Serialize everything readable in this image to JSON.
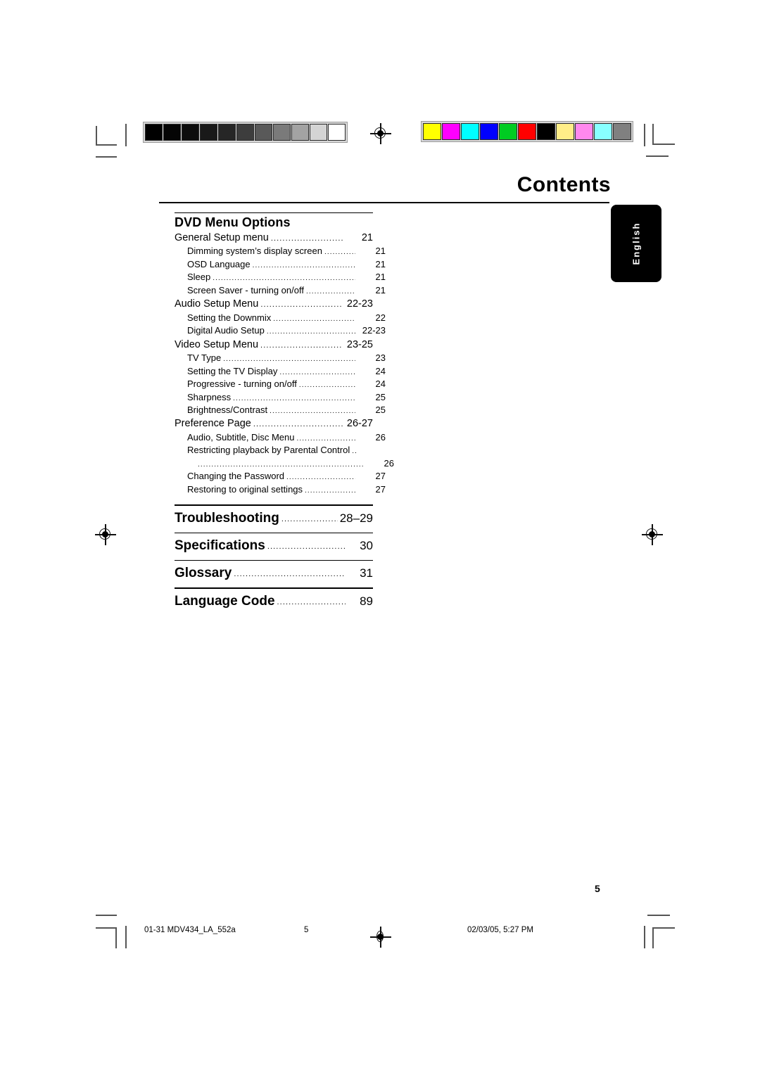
{
  "header": {
    "title": "Contents",
    "language_tab": "English"
  },
  "toc": {
    "group_heading": "DVD Menu Options",
    "entries": [
      {
        "level": 1,
        "label": "General Setup menu",
        "page": "21"
      },
      {
        "level": 2,
        "label": "Dimming system’s display screen",
        "page": "21"
      },
      {
        "level": 2,
        "label": "OSD Language",
        "page": "21"
      },
      {
        "level": 2,
        "label": "Sleep",
        "page": "21"
      },
      {
        "level": 2,
        "label": "Screen Saver - turning on/off",
        "page": "21"
      },
      {
        "level": 1,
        "label": "Audio Setup Menu",
        "page": "22-23"
      },
      {
        "level": 2,
        "label": "Setting the Downmix",
        "page": "22"
      },
      {
        "level": 2,
        "label": "Digital Audio Setup",
        "page": "22-23"
      },
      {
        "level": 1,
        "label": "Video Setup Menu",
        "page": "23-25"
      },
      {
        "level": 2,
        "label": "TV Type",
        "page": "23"
      },
      {
        "level": 2,
        "label": "Setting the TV Display",
        "page": "24"
      },
      {
        "level": 2,
        "label": "Progressive - turning on/off",
        "page": "24"
      },
      {
        "level": 2,
        "label": "Sharpness",
        "page": "25"
      },
      {
        "level": 2,
        "label": "Brightness/Contrast",
        "page": "25"
      },
      {
        "level": 1,
        "label": "Preference Page",
        "page": "26-27"
      },
      {
        "level": 2,
        "label": "Audio, Subtitle, Disc Menu",
        "page": "26"
      },
      {
        "level": 2,
        "label": "Restricting playback by Parental Control",
        "page": ""
      },
      {
        "level": 2,
        "label": "",
        "page": "26",
        "continuation": true
      },
      {
        "level": 2,
        "label": "Changing the Password",
        "page": "27"
      },
      {
        "level": 2,
        "label": "Restoring to original settings",
        "page": "27"
      }
    ],
    "sections": [
      {
        "label": "Troubleshooting",
        "page": "28–29"
      },
      {
        "label": "Specifications",
        "page": "30"
      },
      {
        "label": "Glossary",
        "page": "31"
      },
      {
        "label": "Language Code",
        "page": "89"
      }
    ]
  },
  "page_number": "5",
  "footer": {
    "file": "01-31 MDV434_LA_552a",
    "page": "5",
    "date": "02/03/05, 5:27 PM"
  },
  "calibration": {
    "gray_bar": [
      "#000000",
      "#050505",
      "#0d0d0d",
      "#191919",
      "#262626",
      "#3d3d3d",
      "#595959",
      "#7a7a7a",
      "#a3a3a3",
      "#d4d4d4",
      "#ffffff"
    ],
    "color_bar": [
      "#ffff00",
      "#ff00ff",
      "#00ffff",
      "#0000ff",
      "#00cc22",
      "#ff0000",
      "#000000",
      "#ffee88",
      "#ff88ee",
      "#88ffff",
      "#808080"
    ]
  }
}
